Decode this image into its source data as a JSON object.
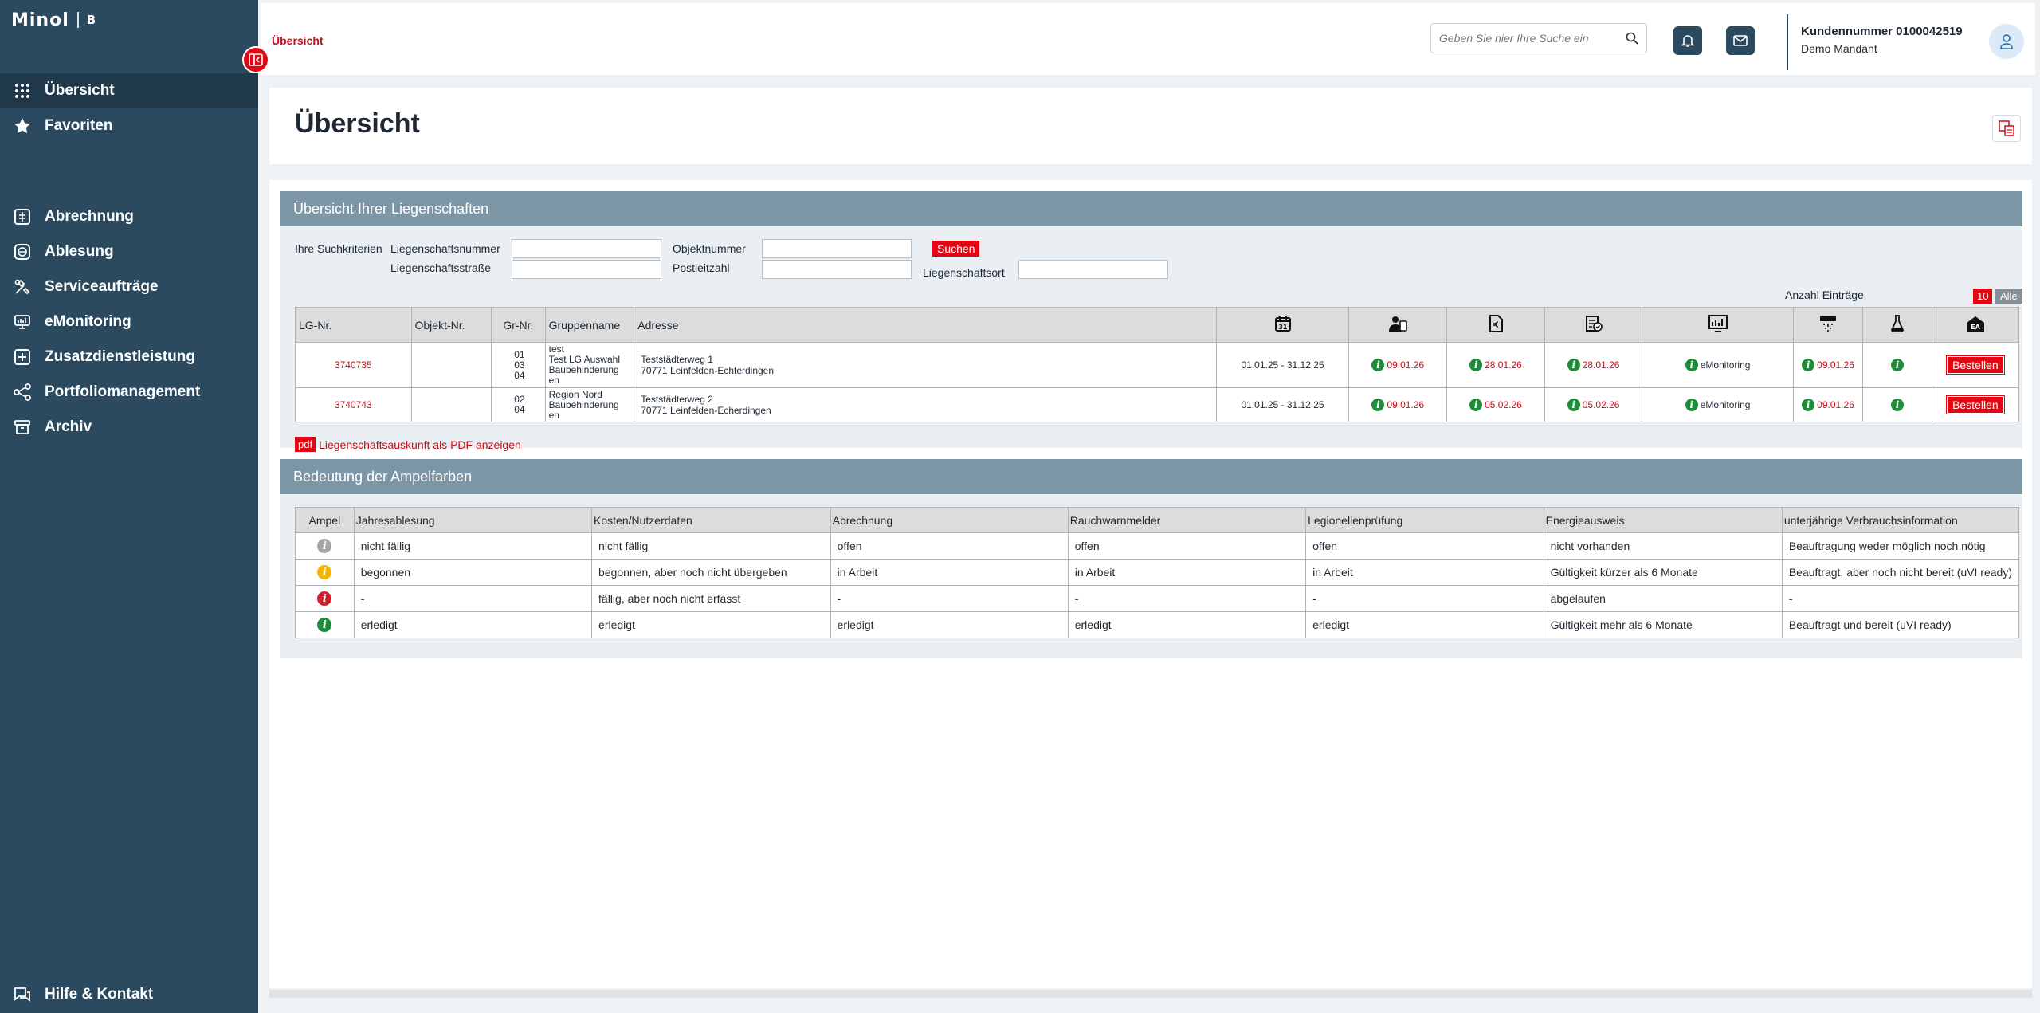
{
  "sidebar": {
    "logo": "Minol",
    "logo_sub": "B",
    "items": [
      {
        "label": "Übersicht",
        "icon": "grid-icon"
      },
      {
        "label": "Favoriten",
        "icon": "star-icon"
      },
      {
        "label": "Abrechnung",
        "icon": "bill-icon"
      },
      {
        "label": "Ablesung",
        "icon": "meter-icon"
      },
      {
        "label": "Serviceaufträge",
        "icon": "tools-icon"
      },
      {
        "label": "eMonitoring",
        "icon": "monitor-icon"
      },
      {
        "label": "Zusatzdienstleistung",
        "icon": "plus-box-icon"
      },
      {
        "label": "Portfoliomanagement",
        "icon": "share-icon"
      },
      {
        "label": "Archiv",
        "icon": "archive-icon"
      }
    ],
    "help": "Hilfe & Kontakt"
  },
  "header": {
    "breadcrumb": "Übersicht",
    "search_placeholder": "Geben Sie hier Ihre Suche ein",
    "customer_number": "Kundennummer 0100042519",
    "tenant": "Demo Mandant"
  },
  "page": {
    "title": "Übersicht"
  },
  "properties": {
    "title": "Übersicht Ihrer Liegenschaften",
    "criteria_label": "Ihre Suchkriterien",
    "labels": {
      "lg_nr": "Liegenschaftsnummer",
      "objekt": "Objektnummer",
      "strasse": "Liegenschaftsstraße",
      "plz": "Postleitzahl",
      "ort": "Liegenschaftsort"
    },
    "search_button": "Suchen",
    "entries_label": "Anzahl Einträge",
    "entries_10": "10",
    "entries_all": "Alle",
    "columns": [
      "LG-Nr.",
      "Objekt-Nr.",
      "Gr-Nr.",
      "Gruppenname",
      "Adresse"
    ],
    "icon_columns": [
      "calendar-icon",
      "meter-reader-icon",
      "invoice-icon",
      "billing-check-icon",
      "emonitoring-icon",
      "smoke-detector-icon",
      "legionella-flask-icon",
      "energy-certificate-icon"
    ],
    "calendar_day": "31",
    "ea_label": "EA",
    "rows": [
      {
        "lg": "3740735",
        "obj": "",
        "gr": "01\n03\n04",
        "group": "test\nTest LG Auswahl\nBaubehinderung\nen",
        "address": "Teststädterweg 1\n70771 Leinfelden-Echterdingen",
        "period": "01.01.25 - 31.12.25",
        "d1": "09.01.26",
        "d2": "28.01.26",
        "d3": "28.01.26",
        "emon": "eMonitoring",
        "d5": "09.01.26",
        "order": "Bestellen"
      },
      {
        "lg": "3740743",
        "obj": "",
        "gr": "02\n04",
        "group": "Region Nord\nBaubehinderung\nen",
        "address": "Teststädterweg 2\n70771 Leinfelden-Echerdingen",
        "period": "01.01.25 - 31.12.25",
        "d1": "09.01.26",
        "d2": "05.02.26",
        "d3": "05.02.26",
        "emon": "eMonitoring",
        "d5": "09.01.26",
        "order": "Bestellen"
      }
    ],
    "pdf_badge": "pdf",
    "pdf_text": "Liegenschaftsauskunft als PDF anzeigen"
  },
  "legend": {
    "title": "Bedeutung der Ampelfarben",
    "columns": [
      "Ampel",
      "Jahresablesung",
      "Kosten/Nutzerdaten",
      "Abrechnung",
      "Rauchwarnmelder",
      "Legionellenprüfung",
      "Energieausweis",
      "unterjährige Verbrauchsinformation"
    ],
    "rows": [
      {
        "color": "#a6a6a6",
        "cells": [
          "nicht fällig",
          "nicht fällig",
          "offen",
          "offen",
          "offen",
          "nicht vorhanden",
          "Beauftragung weder möglich noch nötig"
        ]
      },
      {
        "color": "#f5b400",
        "cells": [
          "begonnen",
          "begonnen, aber noch nicht übergeben",
          "in Arbeit",
          "in Arbeit",
          "in Arbeit",
          "Gültigkeit kürzer als 6 Monate",
          "Beauftragt, aber noch nicht bereit (uVI ready)"
        ]
      },
      {
        "color": "#d0202a",
        "cells": [
          "-",
          "fällig, aber noch nicht erfasst",
          "-",
          "-",
          "-",
          "abgelaufen",
          "-"
        ]
      },
      {
        "color": "#1f8c3b",
        "cells": [
          "erledigt",
          "erledigt",
          "erledigt",
          "erledigt",
          "erledigt",
          "Gültigkeit mehr als 6 Monate",
          "Beauftragt und bereit (uVI ready)"
        ]
      }
    ]
  },
  "colors": {
    "sidebar": "#2c4a5f",
    "accent": "#e30613",
    "panel_header": "#7d96a6",
    "status_green": "#1f8c3b"
  }
}
